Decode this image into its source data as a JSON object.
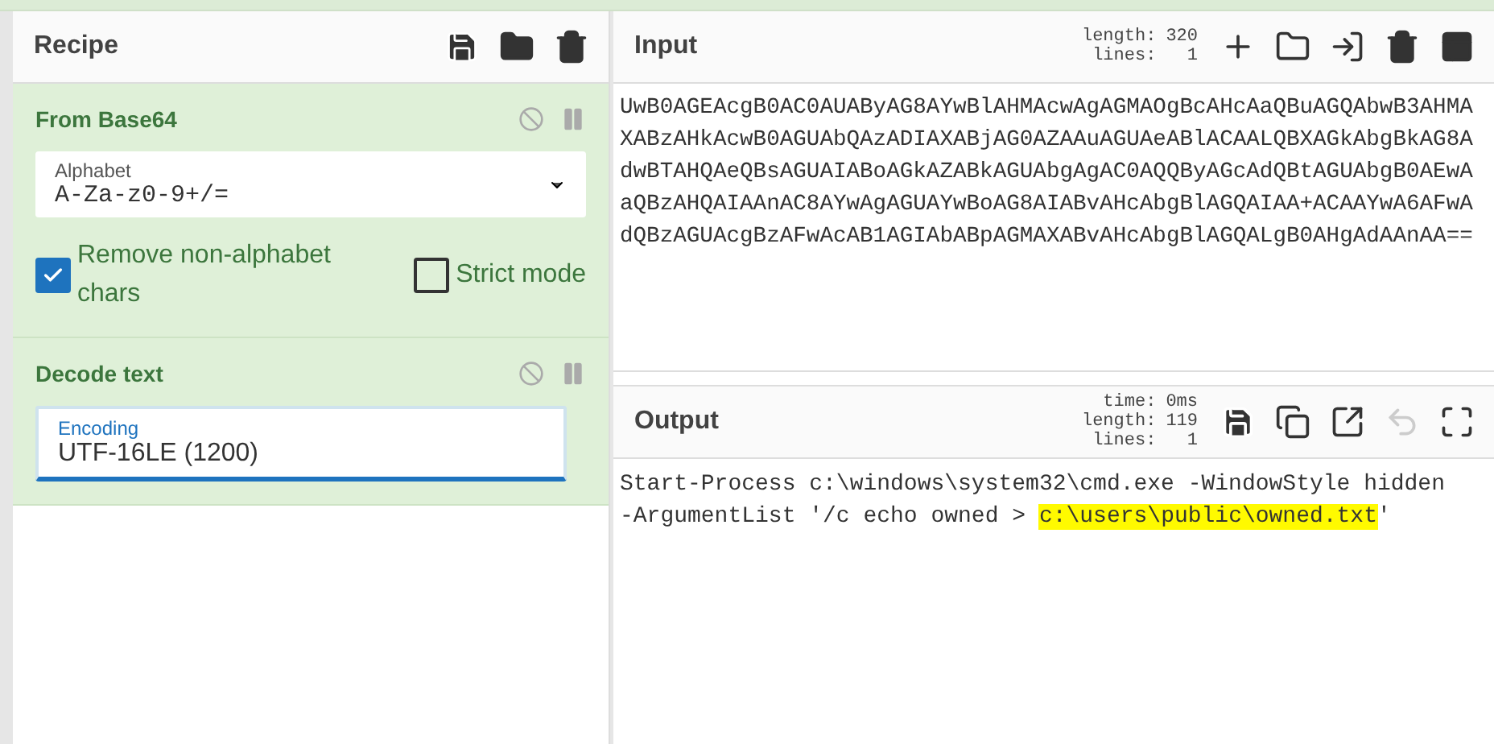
{
  "recipe": {
    "title": "Recipe",
    "operations": [
      {
        "name": "From Base64",
        "disabled": false,
        "paused": false,
        "fields": [
          {
            "kind": "select",
            "label": "Alphabet",
            "value": "A-Za-z0-9+/=",
            "focused": false
          },
          {
            "kind": "checks",
            "items": [
              {
                "label": "Remove non-alphabet chars",
                "checked": true
              },
              {
                "label": "Strict mode",
                "checked": false
              }
            ]
          }
        ]
      },
      {
        "name": "Decode text",
        "disabled": false,
        "paused": false,
        "fields": [
          {
            "kind": "text",
            "label": "Encoding",
            "value": "UTF-16LE (1200)",
            "focused": true
          }
        ]
      }
    ]
  },
  "input": {
    "title": "Input",
    "stats": [
      {
        "label": "length:",
        "value": "320"
      },
      {
        "label": "lines:",
        "value": "1"
      }
    ],
    "lines": [
      "UwB0AGEAcgB0AC0AUAByAG8AYwBlAHMAcwAgAGMAOgBcAHcAaQBuAGQAbwB3AHMA",
      "XABzAHkAcwB0AGUAbQAzADIAXABjAG0AZAAuAGUAeABlACAALQBXAGkAbgBkAG8A",
      "dwBTAHQAeQBsAGUAIABoAGkAZABkAGUAbgAgAC0AQQByAGcAdQBtAGUAbgB0AEwA",
      "aQBzAHQAIAAnAC8AYwAgAGUAYwBoAG8AIABvAHcAbgBlAGQAIAA+ACAAYwA6AFwA",
      "dQBzAGUAcgBzAFwAcAB1AGIAbABpAGMAXABvAHcAbgBlAGQALgB0AHgAdAAnAA=="
    ]
  },
  "output": {
    "title": "Output",
    "stats": [
      {
        "label": "time:",
        "value": "0ms"
      },
      {
        "label": "length:",
        "value": "119"
      },
      {
        "label": "lines:",
        "value": "1"
      }
    ],
    "undo_disabled": true,
    "lines": [
      [
        {
          "text": "Start-Process c:\\windows\\system32\\cmd.exe -WindowStyle hidden",
          "highlighted": false
        }
      ],
      [
        {
          "text": "-ArgumentList '/c echo owned > ",
          "highlighted": false
        },
        {
          "text": "c:\\users\\public\\owned.txt",
          "highlighted": true
        },
        {
          "text": "'",
          "highlighted": false
        }
      ]
    ]
  }
}
